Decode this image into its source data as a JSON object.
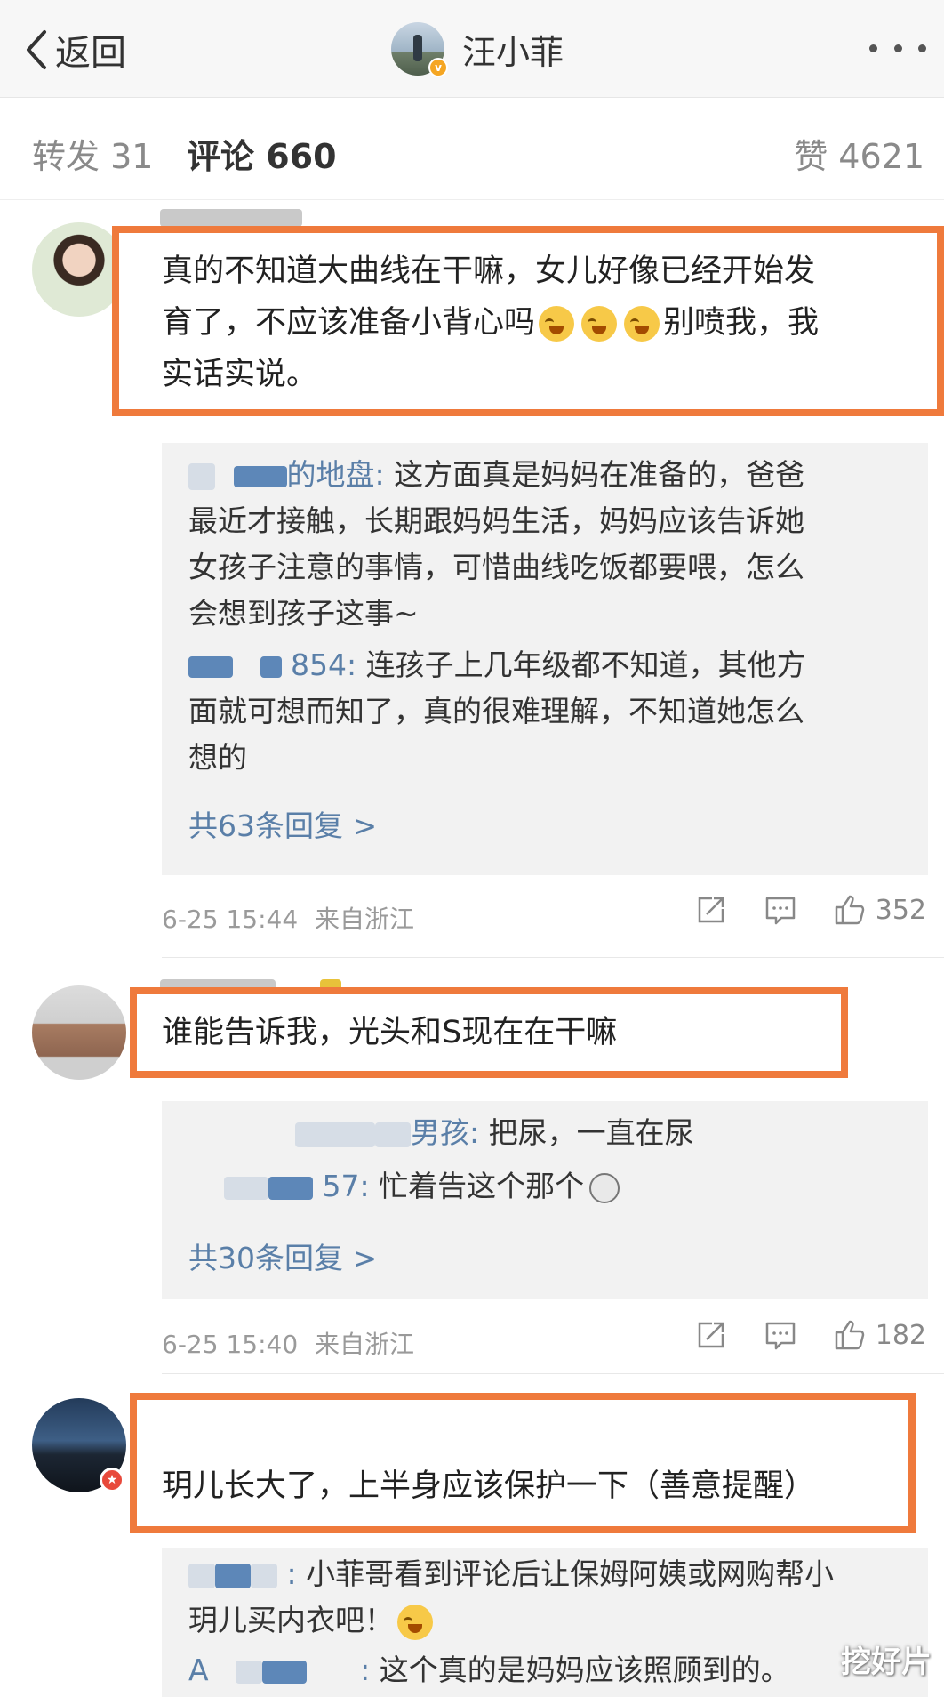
{
  "nav": {
    "back_label": "返回",
    "title": "汪小菲"
  },
  "tabs": {
    "repost": "转发 31",
    "comment": "评论 660",
    "like": "赞 4621"
  },
  "comments": [
    {
      "text_lines": [
        "真的不知道大曲线在干嘛，女儿好像已经开始发",
        "育了，不应该准备小背心吗",
        "别喷我，我",
        "实话实说。"
      ],
      "replies": [
        {
          "nick": "的地盘:",
          "lines": [
            "这方面真是妈妈在准备的，爸爸",
            "最近才接触，长期跟妈妈生活，妈妈应该告诉她",
            "女孩子注意的事情，可惜曲线吃饭都要喂，怎么",
            "会想到孩子这事~"
          ]
        },
        {
          "nick": "854:",
          "lines": [
            "连孩子上几年级都不知道，其他方",
            "面就可想而知了，真的很难理解，不知道她怎么",
            "想的"
          ]
        }
      ],
      "more_replies": "共63条回复 >",
      "time": "6-25 15:44",
      "location": "来自浙江",
      "likes": "352"
    },
    {
      "text_lines": [
        "谁能告诉我，光头和S现在在干嘛"
      ],
      "replies": [
        {
          "nick": "男孩:",
          "lines": [
            "把尿，一直在尿"
          ]
        },
        {
          "nick": "57:",
          "lines": [
            "忙着告这个那个"
          ]
        }
      ],
      "more_replies": "共30条回复 >",
      "time": "6-25 15:40",
      "location": "来自浙江",
      "likes": "182"
    },
    {
      "text_lines": [
        "玥儿长大了，上半身应该保护一下（善意提醒）"
      ],
      "replies": [
        {
          "nick": ":",
          "lines": [
            "小菲哥看到评论后让保姆阿姨或网购帮小",
            "玥儿买内衣吧！"
          ]
        },
        {
          "nick": "A",
          "nick2": ":",
          "lines": [
            "这个真的是妈妈应该照顾到的。"
          ]
        }
      ]
    }
  ],
  "watermark": "挖好片",
  "colors": {
    "highlight": "#ef7a3c",
    "link": "#5a7fa8",
    "reply_bg": "#f2f2f2"
  }
}
